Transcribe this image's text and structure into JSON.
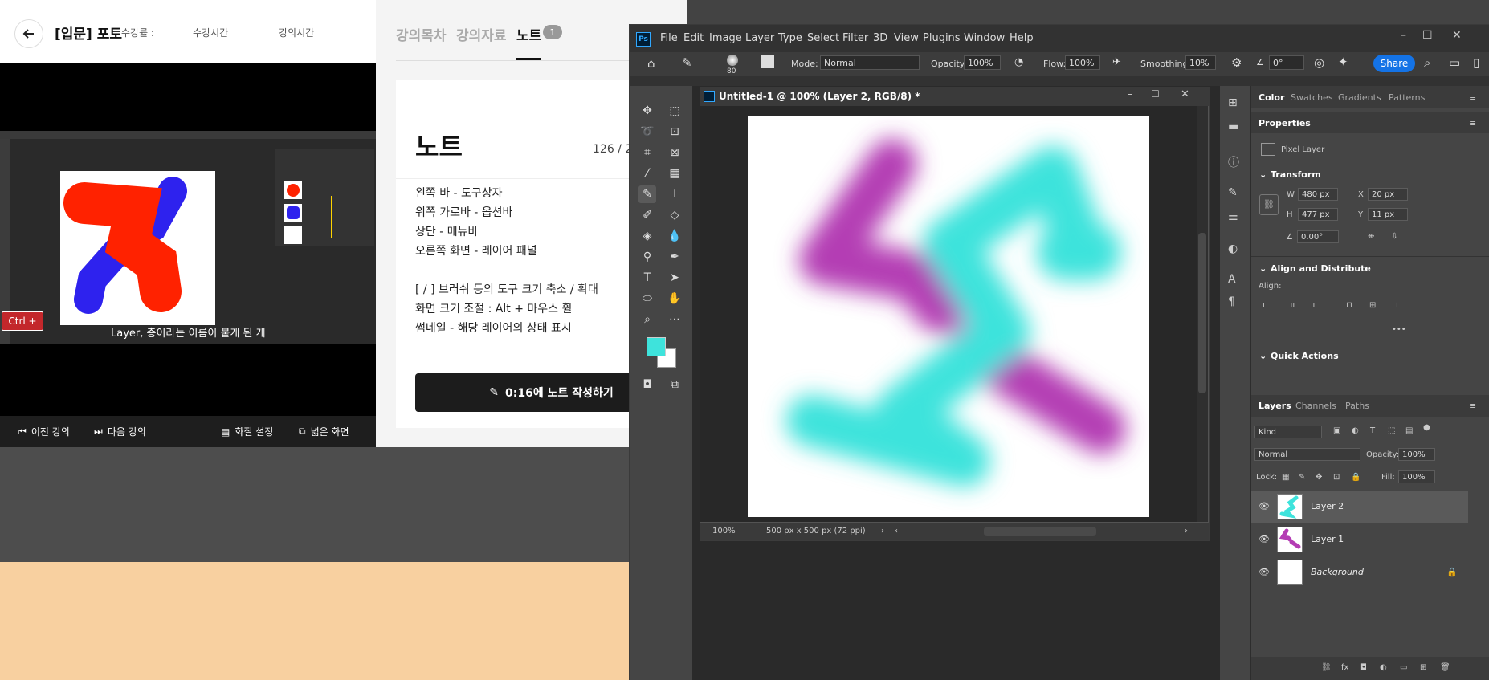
{
  "lecture": {
    "title": "[입문] 포토",
    "meta1": "수강률 :",
    "meta2": "수강시간",
    "meta3": "강의시간",
    "video_caption": "Layer, 층이라는 이름이 붙게 된 게",
    "ctrl_badge": "Ctrl +",
    "bottom_bar": {
      "prev": "이전 강의",
      "next": "다음 강의",
      "quality": "화질 설정",
      "wide": "넓은 화면"
    }
  },
  "notes": {
    "tabs": [
      "강의목차",
      "강의자료",
      "노트"
    ],
    "active_tab_count": "1",
    "title": "노트",
    "counter": "126 / 2",
    "lines": [
      "왼쪽 바 - 도구상자",
      "위쪽 가로바 - 옵션바",
      "상단 - 메뉴바",
      "오른쪽 화면 - 레이어 패널",
      "",
      "[ / ] 브러쉬 등의 도구 크기 축소 / 확대",
      "화면 크기 조절 : Alt + 마우스 휠",
      "썸네일 - 해당 레이어의 상태 표시"
    ],
    "write_button": "0:16에 노트 작성하기"
  },
  "photoshop": {
    "menu": [
      "File",
      "Edit",
      "Image",
      "Layer",
      "Type",
      "Select",
      "Filter",
      "3D",
      "View",
      "Plugins",
      "Window",
      "Help"
    ],
    "options": {
      "brush_size": "80",
      "mode_label": "Mode:",
      "mode_value": "Normal",
      "opacity_label": "Opacity:",
      "opacity_value": "100%",
      "flow_label": "Flow:",
      "flow_value": "100%",
      "smoothing_label": "Smoothing:",
      "smoothing_value": "10%",
      "angle_value": "0°",
      "share": "Share"
    },
    "document": {
      "title": "Untitled-1 @ 100% (Layer 2, RGB/8) *",
      "zoom": "100%",
      "size_info": "500 px x 500 px (72 ppi)"
    },
    "panels": {
      "top_tabs": [
        "Color",
        "Swatches",
        "Gradients",
        "Patterns"
      ],
      "properties_title": "Properties",
      "pixel_layer": "Pixel Layer",
      "transform": "Transform",
      "w_label": "W",
      "w_value": "480 px",
      "h_label": "H",
      "h_value": "477 px",
      "x_label": "X",
      "x_value": "20 px",
      "y_label": "Y",
      "y_value": "11 px",
      "angle_value": "0.00°",
      "align": "Align and Distribute",
      "align_sub": "Align:",
      "quick_actions": "Quick Actions",
      "layer_tabs": [
        "Layers",
        "Channels",
        "Paths"
      ],
      "kind": "Kind",
      "blend": "Normal",
      "opacity_label": "Opacity:",
      "opacity_value": "100%",
      "lock_label": "Lock:",
      "fill_label": "Fill:",
      "fill_value": "100%",
      "layers": [
        "Layer 2",
        "Layer 1",
        "Background"
      ]
    },
    "colors": {
      "cyan": "#3ee3dc",
      "magenta": "#b43cb4"
    }
  }
}
